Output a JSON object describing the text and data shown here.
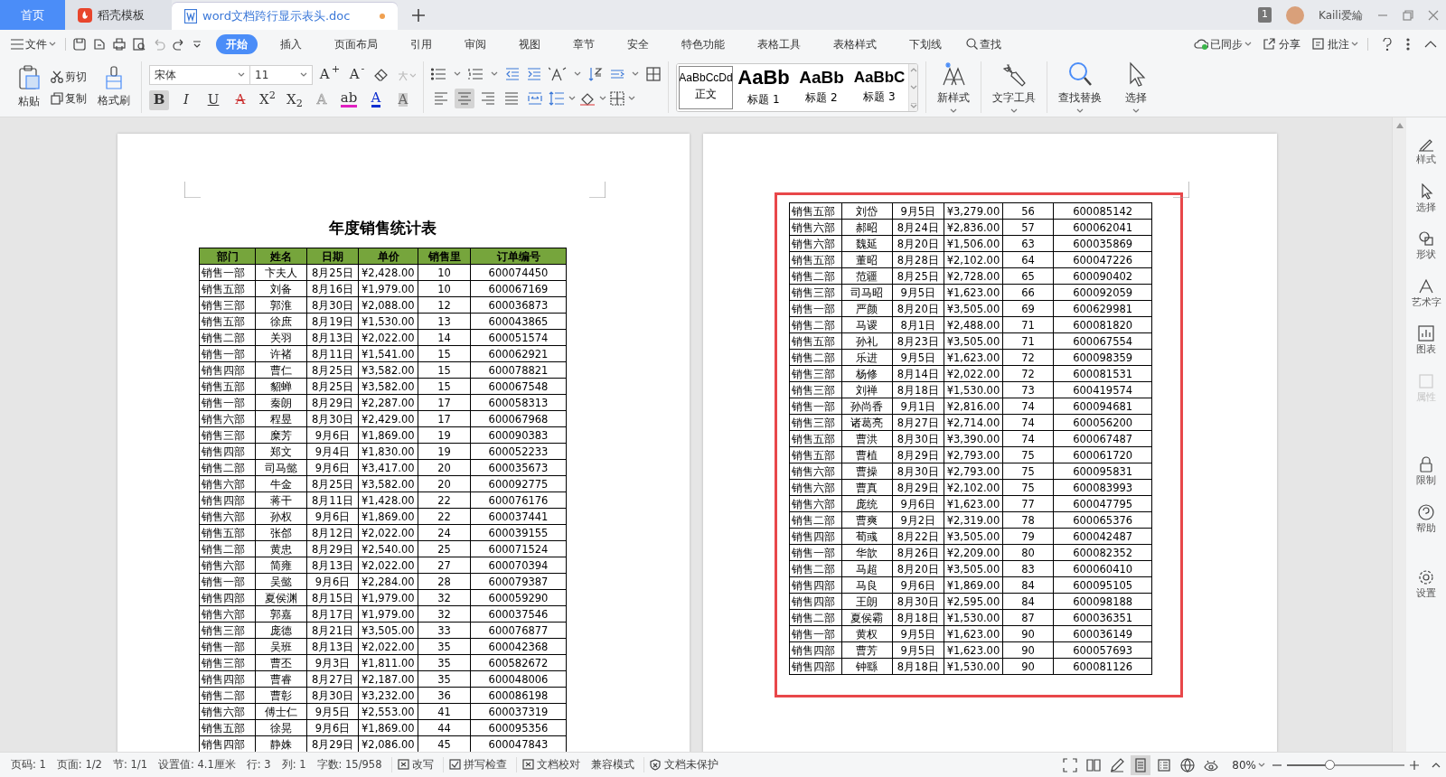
{
  "tabs": [
    {
      "kind": "home",
      "label": "首页",
      "selected": false,
      "modified": false
    },
    {
      "kind": "template",
      "label": "稻壳模板",
      "selected": false,
      "modified": false
    },
    {
      "kind": "document",
      "label": "word文档跨行显示表头.doc",
      "selected": true,
      "modified": true
    }
  ],
  "account": {
    "count": "1",
    "user": "Kaili爱綸"
  },
  "menu": {
    "file": "文件",
    "tabs": [
      {
        "label": "开始",
        "selected": true
      },
      {
        "label": "插入",
        "selected": false
      },
      {
        "label": "页面布局",
        "selected": false
      },
      {
        "label": "引用",
        "selected": false
      },
      {
        "label": "审阅",
        "selected": false
      },
      {
        "label": "视图",
        "selected": false
      },
      {
        "label": "章节",
        "selected": false
      },
      {
        "label": "安全",
        "selected": false
      },
      {
        "label": "特色功能",
        "selected": false
      },
      {
        "label": "表格工具",
        "selected": false
      },
      {
        "label": "表格样式",
        "selected": false
      },
      {
        "label": "下划线",
        "selected": false
      }
    ],
    "search": "查找",
    "actions": [
      {
        "kind": "sync",
        "label": "已同步"
      },
      {
        "kind": "share",
        "label": "分享"
      },
      {
        "kind": "comment",
        "label": "批注"
      }
    ]
  },
  "ribbon": {
    "clipboard": {
      "paste": "粘贴",
      "cut": "剪切",
      "copy": "复制",
      "painter": "格式刷"
    },
    "font": {
      "name": "宋体",
      "size": "11",
      "grow": "A$^{+}$",
      "shrink": "A$^{-}$"
    },
    "format": [
      {
        "kind": "bold",
        "label": "B",
        "active": true
      },
      {
        "kind": "italic",
        "label": "I",
        "active": false
      },
      {
        "kind": "underline",
        "label": "U",
        "active": false
      },
      {
        "kind": "strike",
        "label": "A",
        "active": false
      },
      {
        "kind": "superscript",
        "label": "X$^{2}$",
        "active": false
      },
      {
        "kind": "subscript",
        "label": "X$_{2}$",
        "active": false
      },
      {
        "kind": "effect",
        "label": "A",
        "active": false
      },
      {
        "kind": "highlight",
        "label": "ab",
        "active": false
      },
      {
        "kind": "color",
        "label": "A",
        "active": false
      },
      {
        "kind": "shade",
        "label": "A",
        "active": false
      }
    ],
    "align": [
      {
        "kind": "left",
        "active": false
      },
      {
        "kind": "center",
        "active": true
      },
      {
        "kind": "right",
        "active": false
      },
      {
        "kind": "justify",
        "active": false
      },
      {
        "kind": "distribute",
        "active": false
      }
    ],
    "styles": [
      {
        "preview": "AaBbCcDd",
        "label": "正文",
        "selected": true,
        "kind": "body"
      },
      {
        "preview": "AaBb",
        "label": "标题 1",
        "selected": false,
        "kind": "h1"
      },
      {
        "preview": "AaBb",
        "label": "标题 2",
        "selected": false,
        "kind": "h2"
      },
      {
        "preview": "AaBbC",
        "label": "标题 3",
        "selected": false,
        "kind": "h3"
      }
    ],
    "tools": [
      {
        "kind": "new-style",
        "label": "新样式"
      },
      {
        "kind": "text-tools",
        "label": "文字工具"
      },
      {
        "kind": "find",
        "label": "查找替换"
      },
      {
        "kind": "select",
        "label": "选择"
      }
    ]
  },
  "document": {
    "title": "年度销售统计表",
    "columns": [
      "部门",
      "姓名",
      "日期",
      "单价",
      "销售里",
      "订单编号"
    ],
    "page1_rows": [
      [
        "销售一部",
        "卞夫人",
        "8月25日",
        "¥2,428.00",
        "10",
        "600074450"
      ],
      [
        "销售五部",
        "刘备",
        "8月16日",
        "¥1,979.00",
        "10",
        "600067169"
      ],
      [
        "销售三部",
        "郭淮",
        "8月30日",
        "¥2,088.00",
        "12",
        "600036873"
      ],
      [
        "销售五部",
        "徐庶",
        "8月19日",
        "¥1,530.00",
        "13",
        "600043865"
      ],
      [
        "销售二部",
        "关羽",
        "8月13日",
        "¥2,022.00",
        "14",
        "600051574"
      ],
      [
        "销售一部",
        "许褚",
        "8月11日",
        "¥1,541.00",
        "15",
        "600062921"
      ],
      [
        "销售四部",
        "曹仁",
        "8月25日",
        "¥3,582.00",
        "15",
        "600078821"
      ],
      [
        "销售五部",
        "貂蝉",
        "8月25日",
        "¥3,582.00",
        "15",
        "600067548"
      ],
      [
        "销售一部",
        "秦朗",
        "8月29日",
        "¥2,287.00",
        "17",
        "600058313"
      ],
      [
        "销售六部",
        "程昱",
        "8月30日",
        "¥2,429.00",
        "17",
        "600067968"
      ],
      [
        "销售三部",
        "糜芳",
        "9月6日",
        "¥1,869.00",
        "19",
        "600090383"
      ],
      [
        "销售四部",
        "郑文",
        "9月4日",
        "¥1,830.00",
        "19",
        "600052233"
      ],
      [
        "销售二部",
        "司马懿",
        "9月6日",
        "¥3,417.00",
        "20",
        "600035673"
      ],
      [
        "销售六部",
        "牛金",
        "8月25日",
        "¥3,582.00",
        "20",
        "600092775"
      ],
      [
        "销售四部",
        "蒋干",
        "8月11日",
        "¥1,428.00",
        "22",
        "600076176"
      ],
      [
        "销售六部",
        "孙权",
        "9月6日",
        "¥1,869.00",
        "22",
        "600037441"
      ],
      [
        "销售五部",
        "张郃",
        "8月12日",
        "¥2,022.00",
        "24",
        "600039155"
      ],
      [
        "销售二部",
        "黄忠",
        "8月29日",
        "¥2,540.00",
        "25",
        "600071524"
      ],
      [
        "销售六部",
        "简雍",
        "8月13日",
        "¥2,022.00",
        "27",
        "600070394"
      ],
      [
        "销售一部",
        "吴懿",
        "9月6日",
        "¥2,284.00",
        "28",
        "600079387"
      ],
      [
        "销售四部",
        "夏侯渊",
        "8月15日",
        "¥1,979.00",
        "32",
        "600059290"
      ],
      [
        "销售六部",
        "郭嘉",
        "8月17日",
        "¥1,979.00",
        "32",
        "600037546"
      ],
      [
        "销售三部",
        "庞德",
        "8月21日",
        "¥3,505.00",
        "33",
        "600076877"
      ],
      [
        "销售一部",
        "吴班",
        "8月13日",
        "¥2,022.00",
        "35",
        "600042368"
      ],
      [
        "销售三部",
        "曹丕",
        "9月3日",
        "¥1,811.00",
        "35",
        "600582672"
      ],
      [
        "销售四部",
        "曹睿",
        "8月27日",
        "¥2,187.00",
        "35",
        "600048006"
      ],
      [
        "销售二部",
        "曹彰",
        "8月30日",
        "¥3,232.00",
        "36",
        "600086198"
      ],
      [
        "销售六部",
        "傅士仁",
        "9月5日",
        "¥2,553.00",
        "41",
        "600037319"
      ],
      [
        "销售五部",
        "徐晃",
        "9月6日",
        "¥1,869.00",
        "44",
        "600095356"
      ],
      [
        "销售四部",
        "静姝",
        "8月29日",
        "¥2,086.00",
        "45",
        "600047843"
      ]
    ],
    "page2_rows": [
      [
        "销售五部",
        "刘岱",
        "9月5日",
        "¥3,279.00",
        "56",
        "600085142"
      ],
      [
        "销售六部",
        "郝昭",
        "8月24日",
        "¥2,836.00",
        "57",
        "600062041"
      ],
      [
        "销售六部",
        "魏延",
        "8月20日",
        "¥1,506.00",
        "63",
        "600035869"
      ],
      [
        "销售五部",
        "董昭",
        "8月28日",
        "¥2,102.00",
        "64",
        "600047226"
      ],
      [
        "销售二部",
        "范疆",
        "8月25日",
        "¥2,728.00",
        "65",
        "600090402"
      ],
      [
        "销售三部",
        "司马昭",
        "9月5日",
        "¥1,623.00",
        "66",
        "600092059"
      ],
      [
        "销售一部",
        "严颜",
        "8月20日",
        "¥3,505.00",
        "69",
        "600629981"
      ],
      [
        "销售二部",
        "马谡",
        "8月1日",
        "¥2,488.00",
        "71",
        "600081820"
      ],
      [
        "销售五部",
        "孙礼",
        "8月23日",
        "¥3,505.00",
        "71",
        "600067554"
      ],
      [
        "销售二部",
        "乐进",
        "9月5日",
        "¥1,623.00",
        "72",
        "600098359"
      ],
      [
        "销售三部",
        "杨修",
        "8月14日",
        "¥2,022.00",
        "72",
        "600081531"
      ],
      [
        "销售三部",
        "刘禅",
        "8月18日",
        "¥1,530.00",
        "73",
        "600419574"
      ],
      [
        "销售一部",
        "孙尚香",
        "9月1日",
        "¥2,816.00",
        "74",
        "600094681"
      ],
      [
        "销售三部",
        "诸葛亮",
        "8月27日",
        "¥2,714.00",
        "74",
        "600056200"
      ],
      [
        "销售五部",
        "曹洪",
        "8月30日",
        "¥3,390.00",
        "74",
        "600067487"
      ],
      [
        "销售五部",
        "曹植",
        "8月29日",
        "¥2,793.00",
        "75",
        "600061720"
      ],
      [
        "销售六部",
        "曹操",
        "8月30日",
        "¥2,793.00",
        "75",
        "600095831"
      ],
      [
        "销售六部",
        "曹真",
        "8月29日",
        "¥2,102.00",
        "75",
        "600083993"
      ],
      [
        "销售六部",
        "庞统",
        "9月6日",
        "¥1,623.00",
        "77",
        "600047795"
      ],
      [
        "销售二部",
        "曹爽",
        "9月2日",
        "¥2,319.00",
        "78",
        "600065376"
      ],
      [
        "销售四部",
        "荀彧",
        "8月22日",
        "¥3,505.00",
        "79",
        "600042487"
      ],
      [
        "销售一部",
        "华歆",
        "8月26日",
        "¥2,209.00",
        "80",
        "600082352"
      ],
      [
        "销售二部",
        "马超",
        "8月20日",
        "¥3,505.00",
        "83",
        "600060410"
      ],
      [
        "销售四部",
        "马良",
        "9月6日",
        "¥1,869.00",
        "84",
        "600095105"
      ],
      [
        "销售四部",
        "王朗",
        "8月30日",
        "¥2,595.00",
        "84",
        "600098188"
      ],
      [
        "销售二部",
        "夏侯霸",
        "8月18日",
        "¥1,530.00",
        "87",
        "600036351"
      ],
      [
        "销售一部",
        "黄权",
        "9月5日",
        "¥1,623.00",
        "90",
        "600036149"
      ],
      [
        "销售四部",
        "曹芳",
        "9月5日",
        "¥1,623.00",
        "90",
        "600057693"
      ],
      [
        "销售四部",
        "钟繇",
        "8月18日",
        "¥1,530.00",
        "90",
        "600081126"
      ]
    ]
  },
  "sidebar": [
    {
      "kind": "style",
      "label": "样式",
      "disabled": false
    },
    {
      "kind": "select",
      "label": "选择",
      "disabled": false
    },
    {
      "kind": "shape",
      "label": "形状",
      "disabled": false
    },
    {
      "kind": "art",
      "label": "艺术字",
      "disabled": false
    },
    {
      "kind": "chart",
      "label": "图表",
      "disabled": false
    },
    {
      "kind": "props",
      "label": "属性",
      "disabled": true
    },
    {
      "kind": "lock",
      "label": "限制",
      "disabled": false
    },
    {
      "kind": "help",
      "label": "帮助",
      "disabled": false
    },
    {
      "kind": "settings",
      "label": "设置",
      "disabled": false
    }
  ],
  "status": [
    {
      "kind": "plain",
      "label": "页码: 1"
    },
    {
      "kind": "plain",
      "label": "页面: 1/2"
    },
    {
      "kind": "plain",
      "label": "节: 1/1"
    },
    {
      "kind": "plain",
      "label": "设置值: 4.1厘米"
    },
    {
      "kind": "plain",
      "label": "行: 3"
    },
    {
      "kind": "plain",
      "label": "列: 1"
    },
    {
      "kind": "plain",
      "label": "字数: 15/958"
    },
    {
      "kind": "x-box",
      "label": "改写"
    },
    {
      "kind": "check-box",
      "label": "拼写检查"
    },
    {
      "kind": "x-box",
      "label": "文档校对"
    },
    {
      "kind": "plain",
      "label": "兼容模式"
    },
    {
      "kind": "shield",
      "label": "文档未保护"
    }
  ],
  "views": [
    {
      "kind": "fullscreen",
      "selected": false
    },
    {
      "kind": "book",
      "selected": false
    },
    {
      "kind": "pen",
      "selected": false
    },
    {
      "kind": "page",
      "selected": true
    },
    {
      "kind": "outline",
      "selected": false
    },
    {
      "kind": "web",
      "selected": false
    },
    {
      "kind": "eye",
      "selected": false
    }
  ],
  "zoom": {
    "label": "80%",
    "level": 0.36
  }
}
